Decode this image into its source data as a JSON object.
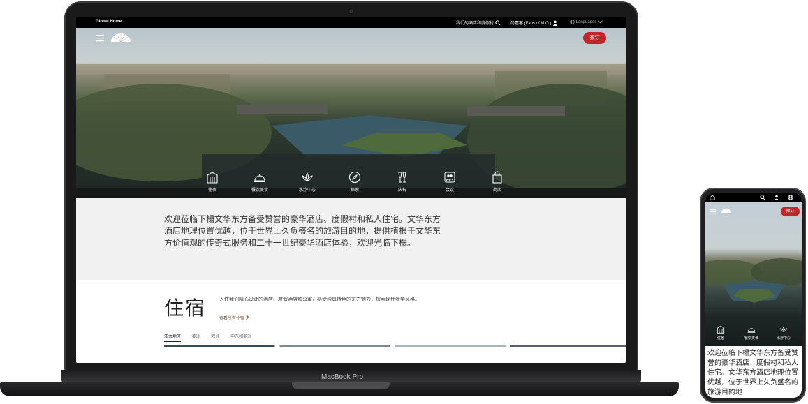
{
  "laptop": {
    "label": "MacBook Pro",
    "site": {
      "topbar": {
        "home": "Global Home",
        "stays": "我们的酒店和度假村",
        "fans": "尚嘉客 (Fans of M.O.)",
        "languages": "Languages"
      },
      "book_label": "预订",
      "nav": [
        "住宿",
        "餐饮美食",
        "水疗中心",
        "探索",
        "庆祝",
        "会议",
        "商店"
      ],
      "welcome": "欢迎莅临下榻文华东方备受赞誉的豪华酒店、度假村和私人住宅。文华东方酒店地理位置优越，位于世界上久负盛名的旅游目的地，提供植根于文华东方价值观的传奇式服务和二十一世纪豪华酒店体验，欢迎光临下榻。",
      "rooms": {
        "title": "住宿",
        "description": "入住我们精心设计的酒店、度假酒店和公寓，感受独具特色的东方魅力，探索现代奢华风格。",
        "link": "查看所有住宿",
        "tabs": [
          "亚太地区",
          "美洲",
          "欧洲",
          "中东和非洲"
        ]
      }
    }
  },
  "phone": {
    "book_label": "预订",
    "nav": [
      "住宿",
      "餐饮美食",
      "水疗中心"
    ],
    "welcome": "欢迎莅临下榻文华东方备受赞誉的豪华酒店、度假村和私人住宅。文华东方酒店地理位置优越，位于世界上久负盛名的旅游目的地"
  },
  "colors": {
    "accent": "#c0262a",
    "topbar": "#000000",
    "welcome_bg": "#f1f1f1"
  },
  "icons": [
    "menu-icon",
    "fan-logo-icon",
    "search-icon",
    "user-icon",
    "globe-icon",
    "chevron-down-icon",
    "building-icon",
    "cloche-icon",
    "lotus-icon",
    "compass-icon",
    "glasses-icon",
    "people-icon",
    "bag-icon",
    "chevron-right-icon"
  ]
}
